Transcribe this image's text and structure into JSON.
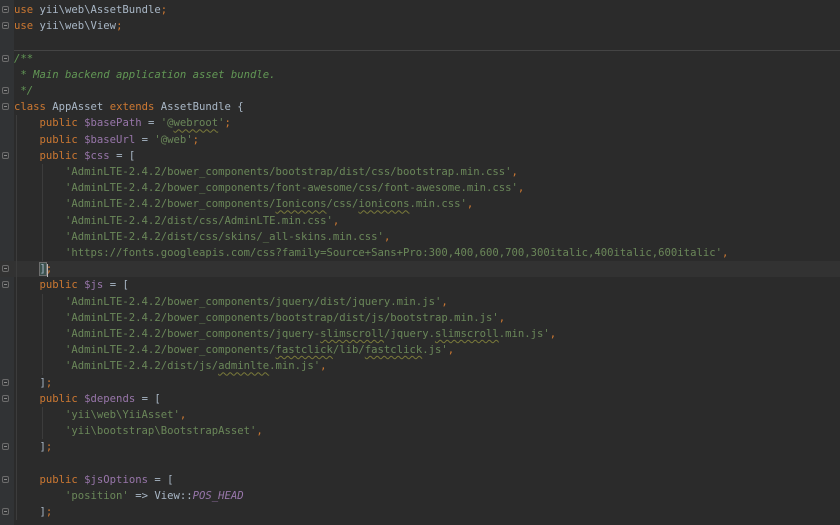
{
  "editor": {
    "language": "php",
    "colors": {
      "background": "#2b2b2b",
      "keyword": "#cc7832",
      "variable": "#9876aa",
      "string": "#6a8759",
      "comment": "#629755",
      "default_text": "#a9b7c6"
    },
    "lines": [
      {
        "tokens": [
          {
            "t": "use",
            "c": "kw"
          },
          {
            "t": " yii\\web\\AssetBundle",
            "c": "plain"
          },
          {
            "t": ";",
            "c": "kw"
          }
        ]
      },
      {
        "tokens": [
          {
            "t": "use",
            "c": "kw"
          },
          {
            "t": " yii\\web\\View",
            "c": "plain"
          },
          {
            "t": ";",
            "c": "kw"
          }
        ]
      },
      {
        "tokens": []
      },
      {
        "tokens": [
          {
            "t": "/**",
            "c": "cmt"
          }
        ]
      },
      {
        "tokens": [
          {
            "t": " * Main backend application asset bundle.",
            "c": "cmt"
          }
        ]
      },
      {
        "tokens": [
          {
            "t": " */",
            "c": "cmt"
          }
        ]
      },
      {
        "tokens": [
          {
            "t": "class ",
            "c": "kw"
          },
          {
            "t": "AppAsset ",
            "c": "plain"
          },
          {
            "t": "extends ",
            "c": "kw"
          },
          {
            "t": "AssetBundle {",
            "c": "plain"
          }
        ]
      },
      {
        "tokens": [
          {
            "t": "    public ",
            "c": "kw"
          },
          {
            "t": "$basePath",
            "c": "var"
          },
          {
            "t": " = ",
            "c": "plain"
          },
          {
            "t": "'@",
            "c": "str"
          },
          {
            "t": "webroot",
            "c": "str sq"
          },
          {
            "t": "'",
            "c": "str"
          },
          {
            "t": ";",
            "c": "kw"
          }
        ]
      },
      {
        "tokens": [
          {
            "t": "    public ",
            "c": "kw"
          },
          {
            "t": "$baseUrl",
            "c": "var"
          },
          {
            "t": " = ",
            "c": "plain"
          },
          {
            "t": "'@web'",
            "c": "str"
          },
          {
            "t": ";",
            "c": "kw"
          }
        ]
      },
      {
        "tokens": [
          {
            "t": "    public ",
            "c": "kw"
          },
          {
            "t": "$css",
            "c": "var"
          },
          {
            "t": " = [",
            "c": "plain"
          }
        ]
      },
      {
        "tokens": [
          {
            "t": "        'AdminLTE-2.4.2/bower_components/bootstrap/dist/css/bootstrap.min.css'",
            "c": "str"
          },
          {
            "t": ",",
            "c": "kw"
          }
        ]
      },
      {
        "tokens": [
          {
            "t": "        'AdminLTE-2.4.2/bower_components/font-awesome/css/font-awesome.min.css'",
            "c": "str"
          },
          {
            "t": ",",
            "c": "kw"
          }
        ]
      },
      {
        "tokens": [
          {
            "t": "        'AdminLTE-2.4.2/bower_components/",
            "c": "str"
          },
          {
            "t": "Ionicons",
            "c": "str sq"
          },
          {
            "t": "/css/",
            "c": "str"
          },
          {
            "t": "ionicons",
            "c": "str sq"
          },
          {
            "t": ".min.css'",
            "c": "str"
          },
          {
            "t": ",",
            "c": "kw"
          }
        ]
      },
      {
        "tokens": [
          {
            "t": "        'AdminLTE-2.4.2/dist/css/AdminLTE.min.css'",
            "c": "str"
          },
          {
            "t": ",",
            "c": "kw"
          }
        ]
      },
      {
        "tokens": [
          {
            "t": "        'AdminLTE-2.4.2/dist/css/skins/_all-skins.min.css'",
            "c": "str"
          },
          {
            "t": ",",
            "c": "kw"
          }
        ]
      },
      {
        "tokens": [
          {
            "t": "        'https://fonts.googleapis.com/css?family=Source+Sans+Pro:300,400,600,700,300italic,400italic,600italic'",
            "c": "str"
          },
          {
            "t": ",",
            "c": "kw"
          }
        ]
      },
      {
        "tokens": [
          {
            "t": "    ",
            "c": "plain"
          },
          {
            "t": "]",
            "c": "plain hl"
          },
          {
            "t": ";",
            "c": "kw"
          }
        ],
        "current": true
      },
      {
        "tokens": [
          {
            "t": "    public ",
            "c": "kw"
          },
          {
            "t": "$js",
            "c": "var"
          },
          {
            "t": " = [",
            "c": "plain"
          }
        ]
      },
      {
        "tokens": [
          {
            "t": "        'AdminLTE-2.4.2/bower_components/jquery/dist/jquery.min.js'",
            "c": "str"
          },
          {
            "t": ",",
            "c": "kw"
          }
        ]
      },
      {
        "tokens": [
          {
            "t": "        'AdminLTE-2.4.2/bower_components/bootstrap/dist/js/bootstrap.min.js'",
            "c": "str"
          },
          {
            "t": ",",
            "c": "kw"
          }
        ]
      },
      {
        "tokens": [
          {
            "t": "        'AdminLTE-2.4.2/bower_components/jquery-",
            "c": "str"
          },
          {
            "t": "slimscroll",
            "c": "str sq"
          },
          {
            "t": "/jquery.",
            "c": "str"
          },
          {
            "t": "slimscroll",
            "c": "str sq"
          },
          {
            "t": ".min.js'",
            "c": "str"
          },
          {
            "t": ",",
            "c": "kw"
          }
        ]
      },
      {
        "tokens": [
          {
            "t": "        'AdminLTE-2.4.2/bower_components/",
            "c": "str"
          },
          {
            "t": "fastclick",
            "c": "str sq"
          },
          {
            "t": "/lib/",
            "c": "str"
          },
          {
            "t": "fastclick",
            "c": "str sq"
          },
          {
            "t": ".js'",
            "c": "str"
          },
          {
            "t": ",",
            "c": "kw"
          }
        ]
      },
      {
        "tokens": [
          {
            "t": "        'AdminLTE-2.4.2/dist/js/",
            "c": "str"
          },
          {
            "t": "adminlte",
            "c": "str sq"
          },
          {
            "t": ".min.js'",
            "c": "str"
          },
          {
            "t": ",",
            "c": "kw"
          }
        ]
      },
      {
        "tokens": [
          {
            "t": "    ]",
            "c": "plain"
          },
          {
            "t": ";",
            "c": "kw"
          }
        ]
      },
      {
        "tokens": [
          {
            "t": "    public ",
            "c": "kw"
          },
          {
            "t": "$depends",
            "c": "var"
          },
          {
            "t": " = [",
            "c": "plain"
          }
        ]
      },
      {
        "tokens": [
          {
            "t": "        'yii\\web\\YiiAsset'",
            "c": "str"
          },
          {
            "t": ",",
            "c": "kw"
          }
        ]
      },
      {
        "tokens": [
          {
            "t": "        'yii\\bootstrap\\BootstrapAsset'",
            "c": "str"
          },
          {
            "t": ",",
            "c": "kw"
          }
        ]
      },
      {
        "tokens": [
          {
            "t": "    ]",
            "c": "plain"
          },
          {
            "t": ";",
            "c": "kw"
          }
        ]
      },
      {
        "tokens": []
      },
      {
        "tokens": [
          {
            "t": "    public ",
            "c": "kw"
          },
          {
            "t": "$jsOptions",
            "c": "var"
          },
          {
            "t": " = [",
            "c": "plain"
          }
        ]
      },
      {
        "tokens": [
          {
            "t": "        'position'",
            "c": "str"
          },
          {
            "t": " => View::",
            "c": "plain"
          },
          {
            "t": "POS_HEAD",
            "c": "const"
          }
        ]
      },
      {
        "tokens": [
          {
            "t": "    ]",
            "c": "plain"
          },
          {
            "t": ";",
            "c": "kw"
          }
        ]
      }
    ]
  }
}
